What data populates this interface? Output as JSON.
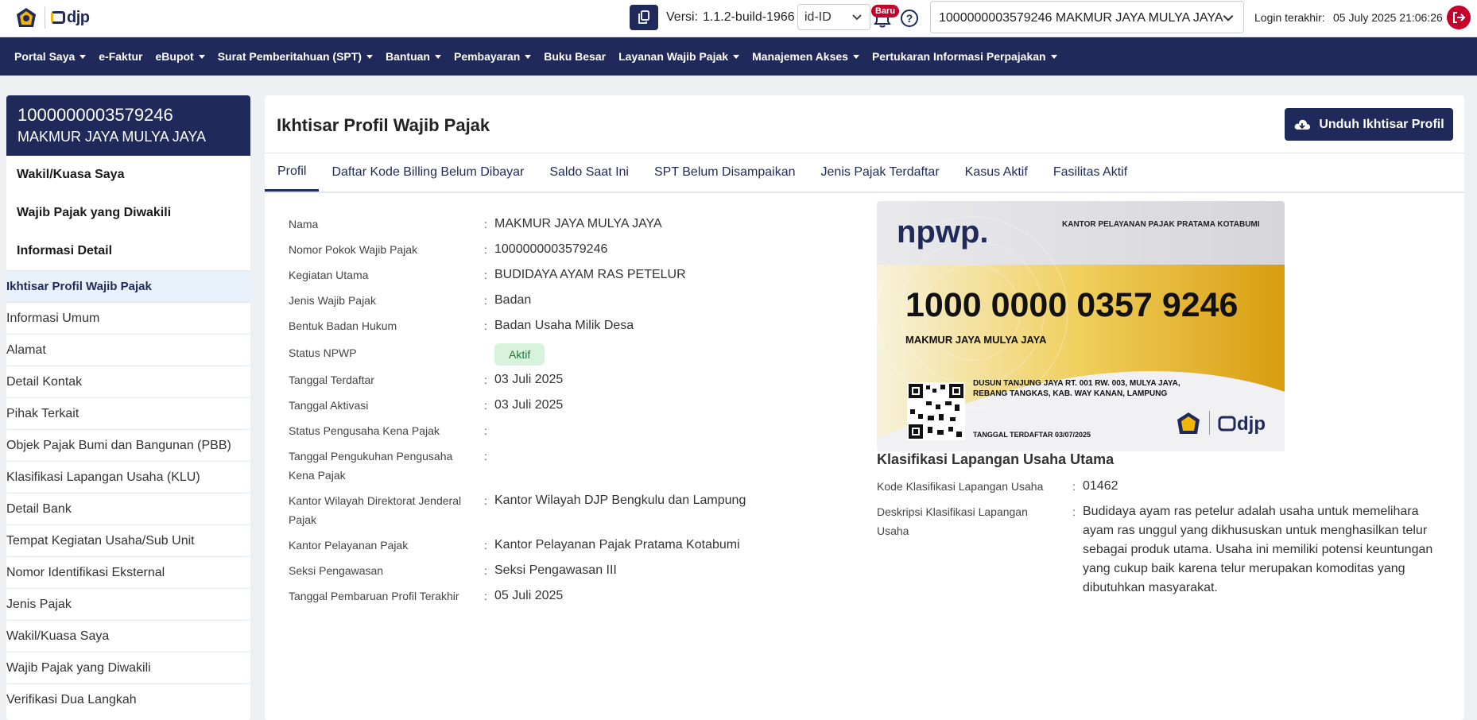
{
  "topbar": {
    "version_label": "Versi:",
    "version_value": "1.1.2-build-1966",
    "language": "id-ID",
    "badge": "Baru",
    "help": "?",
    "account": "1000000003579246 MAKMUR JAYA MULYA JAYA",
    "login_label": "Login terakhir:",
    "login_value": "05 July 2025 21:06:26",
    "logo_text": "djp"
  },
  "nav": [
    {
      "label": "Portal Saya",
      "dropdown": true
    },
    {
      "label": "e-Faktur",
      "dropdown": false
    },
    {
      "label": "eBupot",
      "dropdown": true
    },
    {
      "label": "Surat Pemberitahuan (SPT)",
      "dropdown": true
    },
    {
      "label": "Bantuan",
      "dropdown": true
    },
    {
      "label": "Pembayaran",
      "dropdown": true
    },
    {
      "label": "Buku Besar",
      "dropdown": false
    },
    {
      "label": "Layanan Wajib Pajak",
      "dropdown": true
    },
    {
      "label": "Manajemen Akses",
      "dropdown": true
    },
    {
      "label": "Pertukaran Informasi Perpajakan",
      "dropdown": true
    }
  ],
  "sidebar": {
    "npwp": "1000000003579246",
    "name": "MAKMUR JAYA MULYA JAYA",
    "sections": [
      "Wakil/Kuasa Saya",
      "Wajib Pajak yang Diwakili",
      "Informasi Detail"
    ],
    "items": [
      "Ikhtisar Profil Wajib Pajak",
      "Informasi Umum",
      "Alamat",
      "Detail Kontak",
      "Pihak Terkait",
      "Objek Pajak Bumi dan Bangunan (PBB)",
      "Klasifikasi Lapangan Usaha (KLU)",
      "Detail Bank",
      "Tempat Kegiatan Usaha/Sub Unit",
      "Nomor Identifikasi Eksternal",
      "Jenis Pajak",
      "Wakil/Kuasa Saya",
      "Wajib Pajak yang Diwakili",
      "Verifikasi Dua Langkah"
    ],
    "active_item": "Ikhtisar Profil Wajib Pajak"
  },
  "main": {
    "title": "Ikhtisar Profil Wajib Pajak",
    "download_label": "Unduh Ikhtisar Profil",
    "tabs": [
      "Profil",
      "Daftar Kode Billing Belum Dibayar",
      "Saldo Saat Ini",
      "SPT Belum Disampaikan",
      "Jenis Pajak Terdaftar",
      "Kasus Aktif",
      "Fasilitas Aktif"
    ],
    "active_tab": "Profil"
  },
  "profile": {
    "nama": {
      "label": "Nama",
      "value": "MAKMUR JAYA MULYA JAYA"
    },
    "npwp": {
      "label": "Nomor Pokok Wajib Pajak",
      "value": "1000000003579246"
    },
    "kegiatan": {
      "label": "Kegiatan Utama",
      "value": "BUDIDAYA AYAM RAS PETELUR"
    },
    "jenis": {
      "label": "Jenis Wajib Pajak",
      "value": "Badan"
    },
    "bentuk": {
      "label": "Bentuk Badan Hukum",
      "value": "Badan Usaha Milik Desa"
    },
    "status_npwp": {
      "label": "Status NPWP",
      "value": "Aktif"
    },
    "tgl_daftar": {
      "label": "Tanggal Terdaftar",
      "value": "03 Juli 2025"
    },
    "tgl_aktivasi": {
      "label": "Tanggal Aktivasi",
      "value": "03 Juli 2025"
    },
    "status_pkp": {
      "label": "Status Pengusaha Kena Pajak",
      "value": ""
    },
    "tgl_pkp": {
      "label": "Tanggal Pengukuhan Pengusaha Kena Pajak",
      "value": ""
    },
    "kanwil": {
      "label": "Kantor Wilayah Direktorat Jenderal Pajak",
      "value": "Kantor Wilayah DJP Bengkulu dan Lampung"
    },
    "kpp": {
      "label": "Kantor Pelayanan Pajak",
      "value": "Kantor Pelayanan Pajak Pratama Kotabumi"
    },
    "seksi": {
      "label": "Seksi Pengawasan",
      "value": "Seksi Pengawasan III"
    },
    "tgl_update": {
      "label": "Tanggal Pembaruan Profil Terakhir",
      "value": "05 Juli 2025"
    }
  },
  "card": {
    "logo": "npwp.",
    "kpp": "KANTOR PELAYANAN PAJAK PRATAMA KOTABUMI",
    "number": "1000 0000 0357 9246",
    "name": "MAKMUR JAYA MULYA JAYA",
    "address_line1": "DUSUN TANJUNG JAYA RT.  001 RW.  003, MULYA JAYA,",
    "address_line2": "REBANG TANGKAS, KAB. WAY KANAN, LAMPUNG",
    "registered": "TANGGAL TERDAFTAR 03/07/2025",
    "djp": "djp"
  },
  "klu": {
    "title": "Klasifikasi Lapangan Usaha Utama",
    "kode_label": "Kode Klasifikasi Lapangan Usaha",
    "kode_value": "01462",
    "desc_label": "Deskripsi Klasifikasi Lapangan Usaha",
    "desc_value": "Budidaya ayam ras petelur adalah usaha untuk memelihara ayam ras unggul yang dikhususkan untuk menghasilkan telur sebagai produk utama. Usaha ini memiliki potensi keuntungan yang cukup baik karena telur merupakan komoditas yang dibutuhkan masyarakat."
  },
  "colors": {
    "navy": "#1f2a5a",
    "red": "#c6002b",
    "green_bg": "#d8f3dc",
    "gold": "#e3ac18"
  }
}
